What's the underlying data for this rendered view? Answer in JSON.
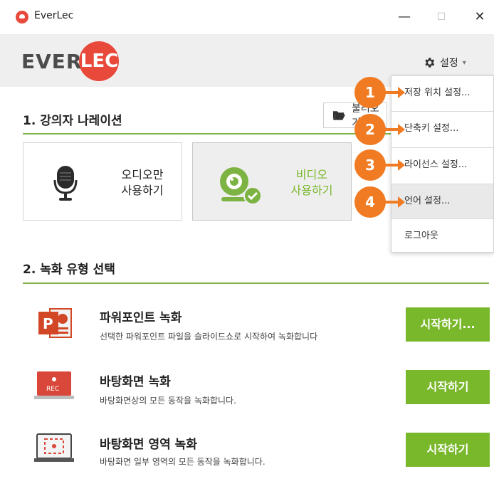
{
  "window": {
    "title": "EverLec",
    "minimize": "—",
    "maximize": "☐",
    "close": "✕"
  },
  "header": {
    "logo_text": "EVER",
    "logo_circle_text": "LEC",
    "settings_label": "설정",
    "settings_caret": "▾"
  },
  "section1": {
    "title": "1. 강의자 나레이션",
    "open_button_label": "불러오기",
    "audio": {
      "line1": "오디오만",
      "line2": "사용하기"
    },
    "video": {
      "line1": "비디오",
      "line2": "사용하기"
    }
  },
  "section2": {
    "title": "2. 녹화 유형 선택",
    "rows": [
      {
        "title": "파워포인트 녹화",
        "desc": "선택한 파워포인트 파일을 슬라이드쇼로 시작하여 녹화합니다",
        "button": "시작하기..."
      },
      {
        "title": "바탕화면 녹화",
        "desc": "바탕화면상의 모든 동작을 녹화합니다.",
        "button": "시작하기"
      },
      {
        "title": "바탕화면 영역 녹화",
        "desc": "바탕화면 일부 영역의 모든 동작을 녹화합니다.",
        "button": "시작하기"
      }
    ],
    "rec_label": "REC"
  },
  "dropdown": {
    "items": [
      {
        "label": "저장 위치 설정..."
      },
      {
        "label": "단축키 설정..."
      },
      {
        "label": "라이선스 설정..."
      },
      {
        "label": "언어 설정..."
      },
      {
        "label": "로그아웃"
      }
    ]
  },
  "badges": [
    "1",
    "2",
    "3",
    "4"
  ],
  "colors": {
    "accent_green": "#79b72b",
    "brand_red": "#e8493a",
    "callout_orange": "#f07b22"
  }
}
